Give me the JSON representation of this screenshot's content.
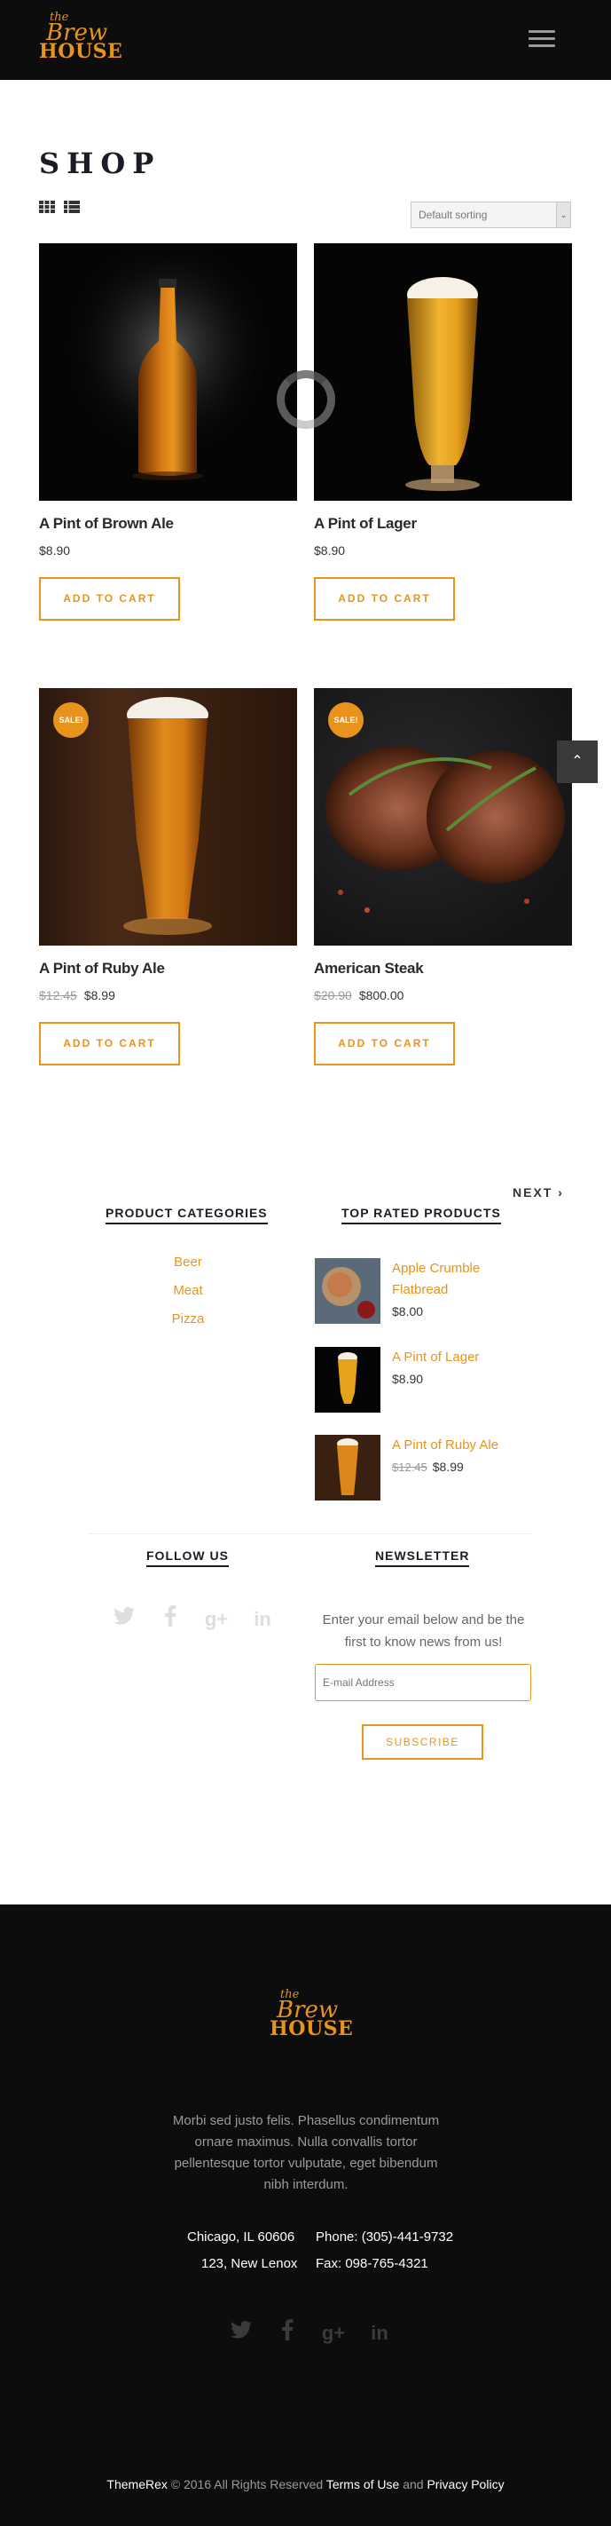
{
  "header": {
    "logo": {
      "the": "the",
      "brew": "Brew",
      "house": "HOUSE"
    },
    "menu_icon": "hamburger-icon"
  },
  "shop": {
    "title": "SHOP",
    "sorting": "Default sorting",
    "products": [
      {
        "name": "A Pint of Brown Ale",
        "price": "$8.90",
        "old_price": "",
        "button": "ADD TO CART",
        "sale": ""
      },
      {
        "name": "A Pint of Lager",
        "price": "$8.90",
        "old_price": "",
        "button": "ADD TO CART",
        "sale": ""
      },
      {
        "name": "A Pint of Ruby Ale",
        "price": "$8.99",
        "old_price": "$12.45",
        "button": "ADD TO CART",
        "sale": "SALE!"
      },
      {
        "name": "American Steak",
        "price": "$800.00",
        "old_price": "$20.90",
        "button": "ADD TO CART",
        "sale": "SALE!"
      }
    ],
    "next": "NEXT"
  },
  "widgets": {
    "categories": {
      "title": "PRODUCT CATEGORIES",
      "items": [
        "Beer",
        "Meat",
        "Pizza"
      ]
    },
    "top_rated": {
      "title": "TOP RATED PRODUCTS",
      "items": [
        {
          "name": "Apple Crumble Flatbread",
          "price": "$8.00",
          "old_price": ""
        },
        {
          "name": "A Pint of Lager",
          "price": "$8.90",
          "old_price": ""
        },
        {
          "name": "A Pint of Ruby Ale",
          "price": "$8.99",
          "old_price": "$12.45"
        }
      ]
    },
    "follow": {
      "title": "FOLLOW US"
    },
    "newsletter": {
      "title": "NEWSLETTER",
      "text": "Enter your email below and be the first to know news from us!",
      "placeholder": "E-mail Address",
      "button": "SUBSCRIBE"
    }
  },
  "footer": {
    "logo": {
      "the": "the",
      "brew": "Brew",
      "house": "HOUSE"
    },
    "text": "Morbi sed justo felis. Phasellus condimentum ornare maximus. Nulla convallis tortor pellentesque tortor vulputate, eget bibendum nibh interdum.",
    "city": "Chicago, IL 60606",
    "street": "123, New Lenox",
    "phone": "Phone: (305)-441-9732",
    "fax": "Fax: 098-765-4321",
    "copyright": {
      "brand": "ThemeRex",
      "middle": "© 2016 All Rights Reserved",
      "terms": "Terms of Use",
      "and": "and",
      "privacy": "Privacy Policy"
    }
  },
  "colors": {
    "accent": "#e8931c",
    "dark": "#0d0d0d",
    "heading": "#1a1d25"
  }
}
